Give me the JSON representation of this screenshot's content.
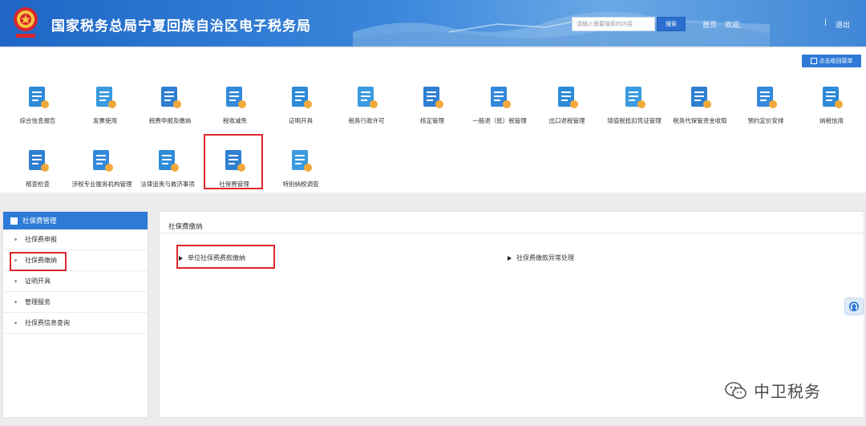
{
  "header": {
    "title": "国家税务总局宁夏回族自治区电子税务局",
    "search_placeholder": "请输入需要搜索的内容",
    "search_button": "搜索",
    "home": "首页",
    "welcome": "欢迎,",
    "separator": "|",
    "logout": "退出"
  },
  "menu": {
    "collapse_label": "点击收回菜单",
    "items": [
      {
        "label": "综合信息报告",
        "icon": "report-icon"
      },
      {
        "label": "发票使用",
        "icon": "invoice-icon"
      },
      {
        "label": "税费申报及缴纳",
        "icon": "tax-declaration-icon"
      },
      {
        "label": "税收减免",
        "icon": "tax-relief-icon"
      },
      {
        "label": "证明开具",
        "icon": "certificate-icon"
      },
      {
        "label": "税务行政许可",
        "icon": "license-icon"
      },
      {
        "label": "核定管理",
        "icon": "tax-assessment-icon"
      },
      {
        "label": "一般退（抵）税管理",
        "icon": "refund-icon"
      },
      {
        "label": "出口退税管理",
        "icon": "export-refund-icon"
      },
      {
        "label": "增值税抵扣凭证管理",
        "icon": "vat-deduction-icon"
      },
      {
        "label": "税务代保管资金收取",
        "icon": "custody-fund-icon"
      },
      {
        "label": "预约定价安排",
        "icon": "pricing-arrangement-icon"
      },
      {
        "label": "纳税信用",
        "icon": "credit-icon"
      },
      {
        "label": "稽查检查",
        "icon": "inspection-icon"
      },
      {
        "label": "涉税专业服务机构管理",
        "icon": "agency-icon"
      },
      {
        "label": "法律追责与救济事项",
        "icon": "legal-icon"
      },
      {
        "label": "社保费管理",
        "icon": "social-security-icon"
      },
      {
        "label": "特别纳税调查",
        "icon": "special-investigation-icon"
      }
    ]
  },
  "sidebar": {
    "title": "社保费管理",
    "items": [
      {
        "label": "社保费申报"
      },
      {
        "label": "社保费缴纳"
      },
      {
        "label": "证明开具"
      },
      {
        "label": "管理服务"
      },
      {
        "label": "社保费信息查询"
      }
    ]
  },
  "main": {
    "title": "社保费缴纳",
    "links": [
      {
        "label": "单位社保费费款缴纳"
      },
      {
        "label": "社保费缴款异常处理"
      }
    ]
  },
  "watermark": {
    "text": "中卫税务"
  },
  "colors": {
    "primary": "#2e7ad6",
    "highlight": "#e0262b",
    "header": "#1f66c6"
  }
}
